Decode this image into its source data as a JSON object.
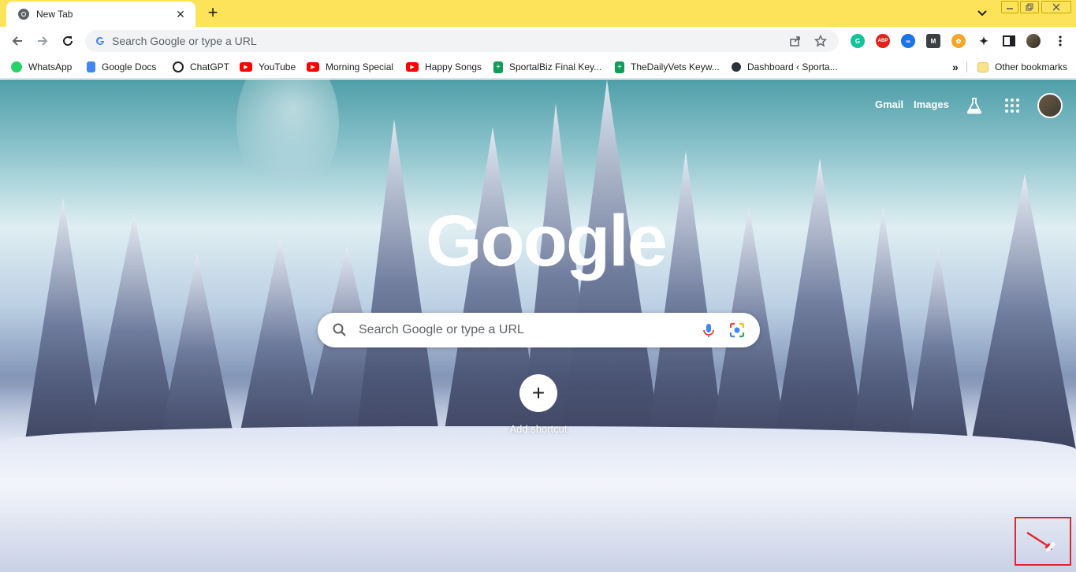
{
  "tab": {
    "title": "New Tab",
    "close": "✕"
  },
  "newtab": {
    "label": "+"
  },
  "omnibox": {
    "placeholder": "Search Google or type a URL"
  },
  "bookmarks": [
    {
      "label": "WhatsApp",
      "color": "#25d366"
    },
    {
      "label": "Google Docs",
      "color": "#4285f4"
    },
    {
      "label": "ChatGPT",
      "color": "#202124"
    },
    {
      "label": "YouTube",
      "color": "#ff0000"
    },
    {
      "label": "Morning Special",
      "color": "#ff0000"
    },
    {
      "label": "Happy Songs",
      "color": "#ff0000"
    },
    {
      "label": "SportalBiz Final Key...",
      "color": "#0f9d58"
    },
    {
      "label": "TheDailyVets Keyw...",
      "color": "#0f9d58"
    },
    {
      "label": "Dashboard ‹ Sporta...",
      "color": "#2c3338"
    }
  ],
  "bookmarks_overflow": "»",
  "other_bookmarks": "Other bookmarks",
  "ntp": {
    "gmail": "Gmail",
    "images": "Images",
    "logo": "Google",
    "search_placeholder": "Search Google or type a URL",
    "add_shortcut": "Add shortcut",
    "add_shortcut_icon": "+"
  },
  "colors": {
    "tabstrip": "#fde35a",
    "highlight": "#e5252a"
  }
}
